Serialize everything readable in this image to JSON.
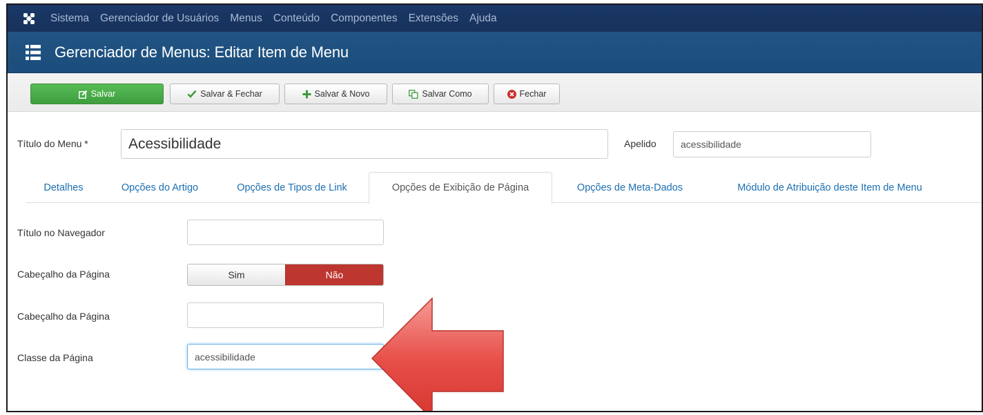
{
  "navbar": {
    "items": [
      "Sistema",
      "Gerenciador de Usuários",
      "Menus",
      "Conteúdo",
      "Componentes",
      "Extensões",
      "Ajuda"
    ]
  },
  "header": {
    "title": "Gerenciador de Menus: Editar Item de Menu"
  },
  "toolbar": {
    "save": "Salvar",
    "save_close": "Salvar & Fechar",
    "save_new": "Salvar & Novo",
    "save_as": "Salvar Como",
    "close": "Fechar"
  },
  "form": {
    "title_label": "Título do Menu *",
    "title_value": "Acessibilidade",
    "alias_label": "Apelido",
    "alias_value": "acessibilidade"
  },
  "tabs": [
    "Detalhes",
    "Opções do Artigo",
    "Opções de Tipos de Link",
    "Opções de Exibição de Página",
    "Opções de Meta-Dados",
    "Módulo de Atribuição deste Item de Menu"
  ],
  "active_tab": "Opções de Exibição de Página",
  "page_display": {
    "browser_title_label": "Título no Navegador",
    "browser_title_value": "",
    "show_heading_label": "Cabeçalho da Página",
    "toggle_yes": "Sim",
    "toggle_no": "Não",
    "toggle_selected": "Não",
    "heading_label": "Cabeçalho da Página",
    "heading_value": "",
    "page_class_label": "Classe da Página",
    "page_class_value": "acessibilidade"
  },
  "colors": {
    "navbar": "#1a3867",
    "header": "#1f5181",
    "primary_button": "#4cae4c",
    "toggle_no": "#bd362f",
    "tab_link": "#1c6fb1",
    "arrow": "#e8504a"
  }
}
